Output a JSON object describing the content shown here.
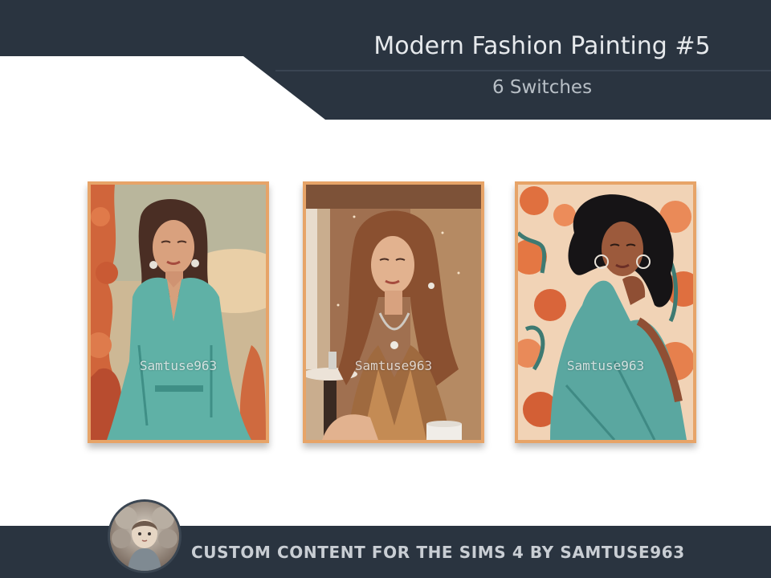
{
  "header": {
    "title": "Modern Fashion Painting #5",
    "subtitle": "6 Switches",
    "band_color": "#2a3440"
  },
  "paintings": [
    {
      "watermark": "Samtuse963",
      "palette": "teal shirt, peach floral",
      "subject": "woman-teal-shirt"
    },
    {
      "watermark": "Samtuse963",
      "palette": "bronze sequin, cafe",
      "subject": "woman-sequin-dress"
    },
    {
      "watermark": "Samtuse963",
      "palette": "teal dress, orange floral",
      "subject": "woman-teal-dress"
    }
  ],
  "frame_color": "#e7a468",
  "footer": {
    "text": "CUSTOM CONTENT FOR THE SIMS 4 BY SAMTUSE963",
    "avatar_icon": "doll-portrait-icon"
  }
}
